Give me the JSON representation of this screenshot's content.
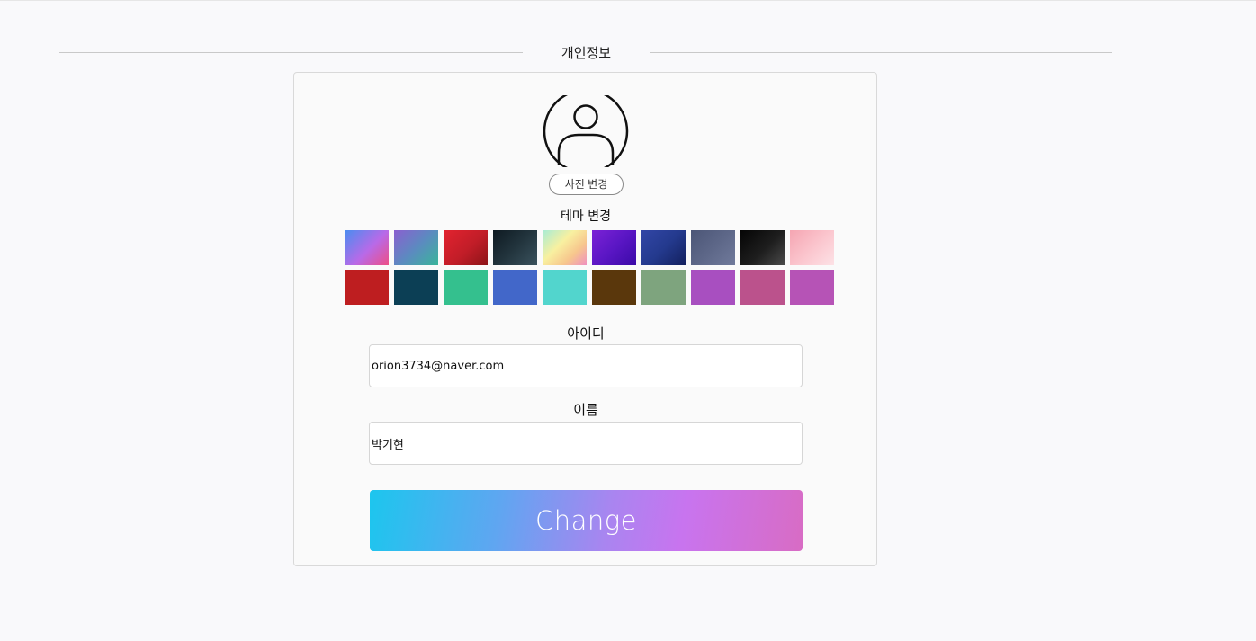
{
  "section": {
    "title": "개인정보"
  },
  "profile": {
    "avatar_icon": "user-circle-icon",
    "change_photo_label": "사진 변경"
  },
  "theme": {
    "label": "테마 변경",
    "swatches": [
      {
        "name": "blue-pink-gradient",
        "css": "linear-gradient(135deg, #4a8df0 0%, #b86ae8 55%, #ee4e86 100%)"
      },
      {
        "name": "purple-teal-gradient",
        "css": "linear-gradient(135deg, #8a5fd0 0%, #5c8ac0 50%, #39b59a 100%)"
      },
      {
        "name": "red-gradient",
        "css": "linear-gradient(135deg, #e2232f 0%, #c11d28 55%, #8c1418 100%)"
      },
      {
        "name": "dark-slate-gradient",
        "css": "linear-gradient(135deg, #0e1a22 0%, #22343d 50%, #3a525d 100%)"
      },
      {
        "name": "pastel-rainbow-gradient",
        "css": "linear-gradient(135deg, #a7ecd5 0%, #f8f0a0 40%, #f7c68d 70%, #ef8fc1 100%)"
      },
      {
        "name": "violet-gradient",
        "css": "linear-gradient(135deg, #7b22d6 0%, #5a16c4 50%, #3b0aa8 100%)"
      },
      {
        "name": "indigo-gradient",
        "css": "linear-gradient(135deg, #3246a6 0%, #243a8e 50%, #13205e 100%)"
      },
      {
        "name": "slate-blue-gradient",
        "css": "linear-gradient(135deg, #4c5677 0%, #5d6788 50%, #707a9b 100%)"
      },
      {
        "name": "black-gradient",
        "css": "linear-gradient(135deg, #050505 0%, #1e1e1e 55%, #4a4a4a 100%)"
      },
      {
        "name": "pink-gradient",
        "css": "linear-gradient(135deg, #f5a5b2 0%, #fbc7cf 55%, #fde2e6 100%)"
      },
      {
        "name": "crimson",
        "css": "#be1e20"
      },
      {
        "name": "dark-teal",
        "css": "#0c3f55"
      },
      {
        "name": "emerald",
        "css": "#34c08e"
      },
      {
        "name": "royal-blue",
        "css": "#4267c9"
      },
      {
        "name": "turquoise",
        "css": "#52d5cd"
      },
      {
        "name": "brown",
        "css": "#5a370c"
      },
      {
        "name": "sage",
        "css": "#7ea47e"
      },
      {
        "name": "purple",
        "css": "#a84fc0"
      },
      {
        "name": "raspberry",
        "css": "#bb528c"
      },
      {
        "name": "orchid",
        "css": "#b653b6"
      }
    ]
  },
  "form": {
    "id_label": "아이디",
    "id_value": "orion3734@naver.com",
    "name_label": "이름",
    "name_value": "박기현",
    "submit_label": "Change"
  }
}
